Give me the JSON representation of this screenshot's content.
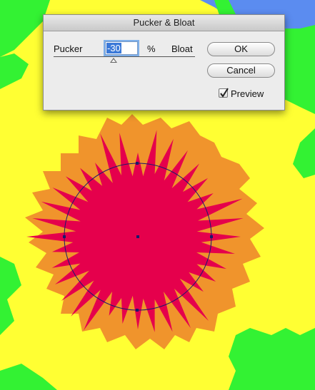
{
  "dialog": {
    "title": "Pucker & Bloat",
    "pucker_label": "Pucker",
    "bloat_label": "Bloat",
    "amount_value": "-30",
    "percent_label": "%",
    "slider_level_percent": -30,
    "ok_label": "OK",
    "cancel_label": "Cancel",
    "preview_label": "Preview",
    "preview_checked": true
  },
  "colors": {
    "background_blue": "#5b8cf0",
    "background_green": "#33f233",
    "background_yellow": "#ffff33",
    "splat_orange": "#f0942c",
    "star_red": "#e5004c",
    "path_navy": "#1a1a6a",
    "field_highlight": "#3b79d8"
  },
  "icons": {
    "preview_checkbox": "checkmark-icon",
    "slider": "triangle-slider-thumb-icon"
  }
}
